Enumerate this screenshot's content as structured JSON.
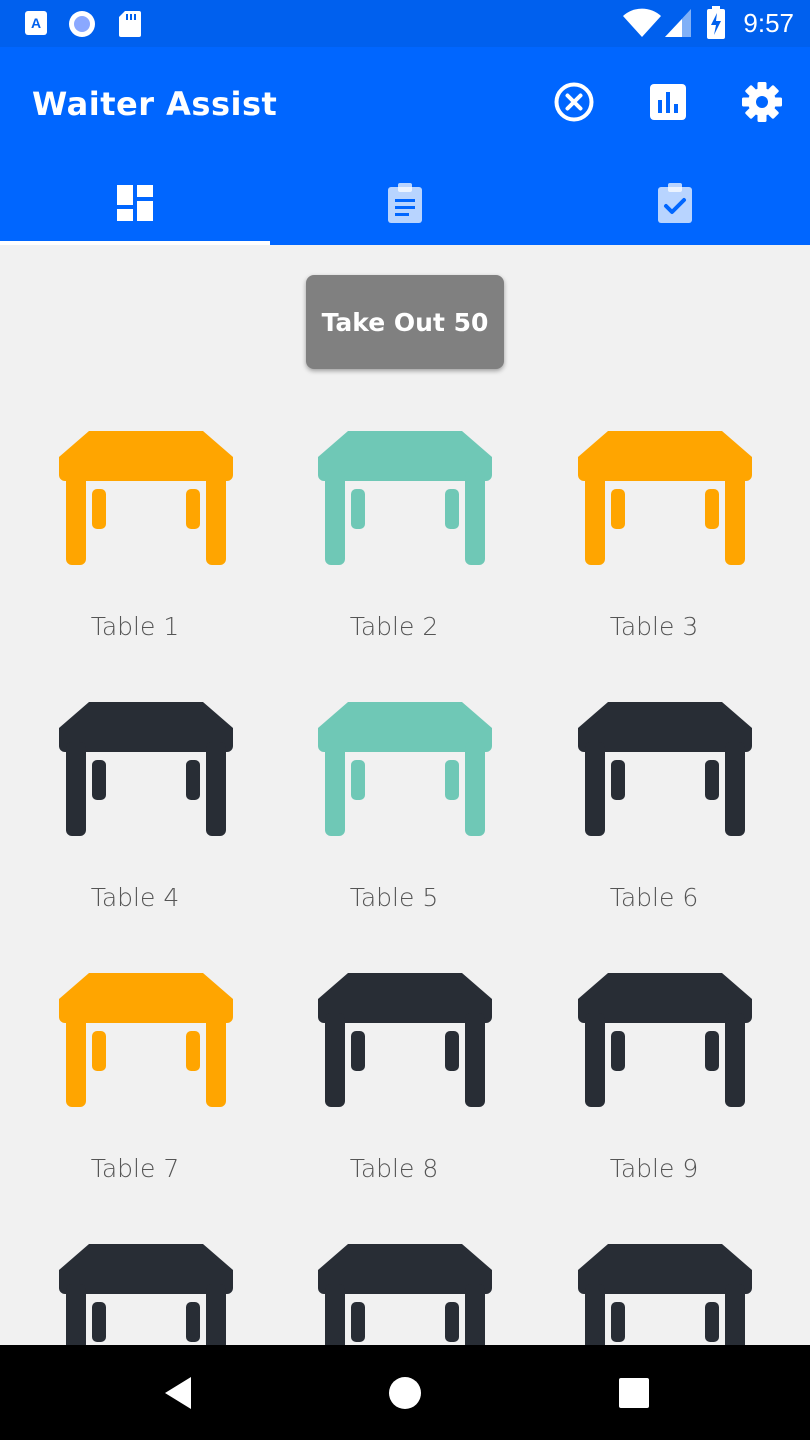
{
  "status_bar": {
    "time": "9:57",
    "icons": [
      "accessibility-app-icon",
      "circle-app-icon",
      "sd-card-icon",
      "wifi-icon",
      "signal-icon",
      "battery-charging-icon"
    ]
  },
  "app_bar": {
    "title": "Waiter Assist",
    "actions": [
      {
        "icon": "cancel-circle-icon"
      },
      {
        "icon": "bar-chart-icon"
      },
      {
        "icon": "gear-icon"
      }
    ]
  },
  "tabs": [
    {
      "icon": "dashboard-icon",
      "selected": true
    },
    {
      "icon": "clipboard-list-icon",
      "selected": false
    },
    {
      "icon": "clipboard-check-icon",
      "selected": false
    }
  ],
  "takeout_button": {
    "label": "Take Out 50"
  },
  "colors": {
    "primary": "#0066ff",
    "status_bar": "#0060ee",
    "occupied": "#ffa500",
    "reserved": "#6fc8b6",
    "free": "#282d35"
  },
  "tables": [
    {
      "label": "Table 1",
      "status": "occupied"
    },
    {
      "label": "Table 2",
      "status": "reserved"
    },
    {
      "label": "Table 3",
      "status": "occupied"
    },
    {
      "label": "Table 4",
      "status": "free"
    },
    {
      "label": "Table 5",
      "status": "reserved"
    },
    {
      "label": "Table 6",
      "status": "free"
    },
    {
      "label": "Table 7",
      "status": "occupied"
    },
    {
      "label": "Table 8",
      "status": "free"
    },
    {
      "label": "Table 9",
      "status": "free"
    },
    {
      "label": "",
      "status": "free"
    },
    {
      "label": "",
      "status": "free"
    },
    {
      "label": "",
      "status": "free"
    }
  ],
  "nav_bar": {
    "buttons": [
      "back-icon",
      "home-icon",
      "recents-icon"
    ]
  }
}
